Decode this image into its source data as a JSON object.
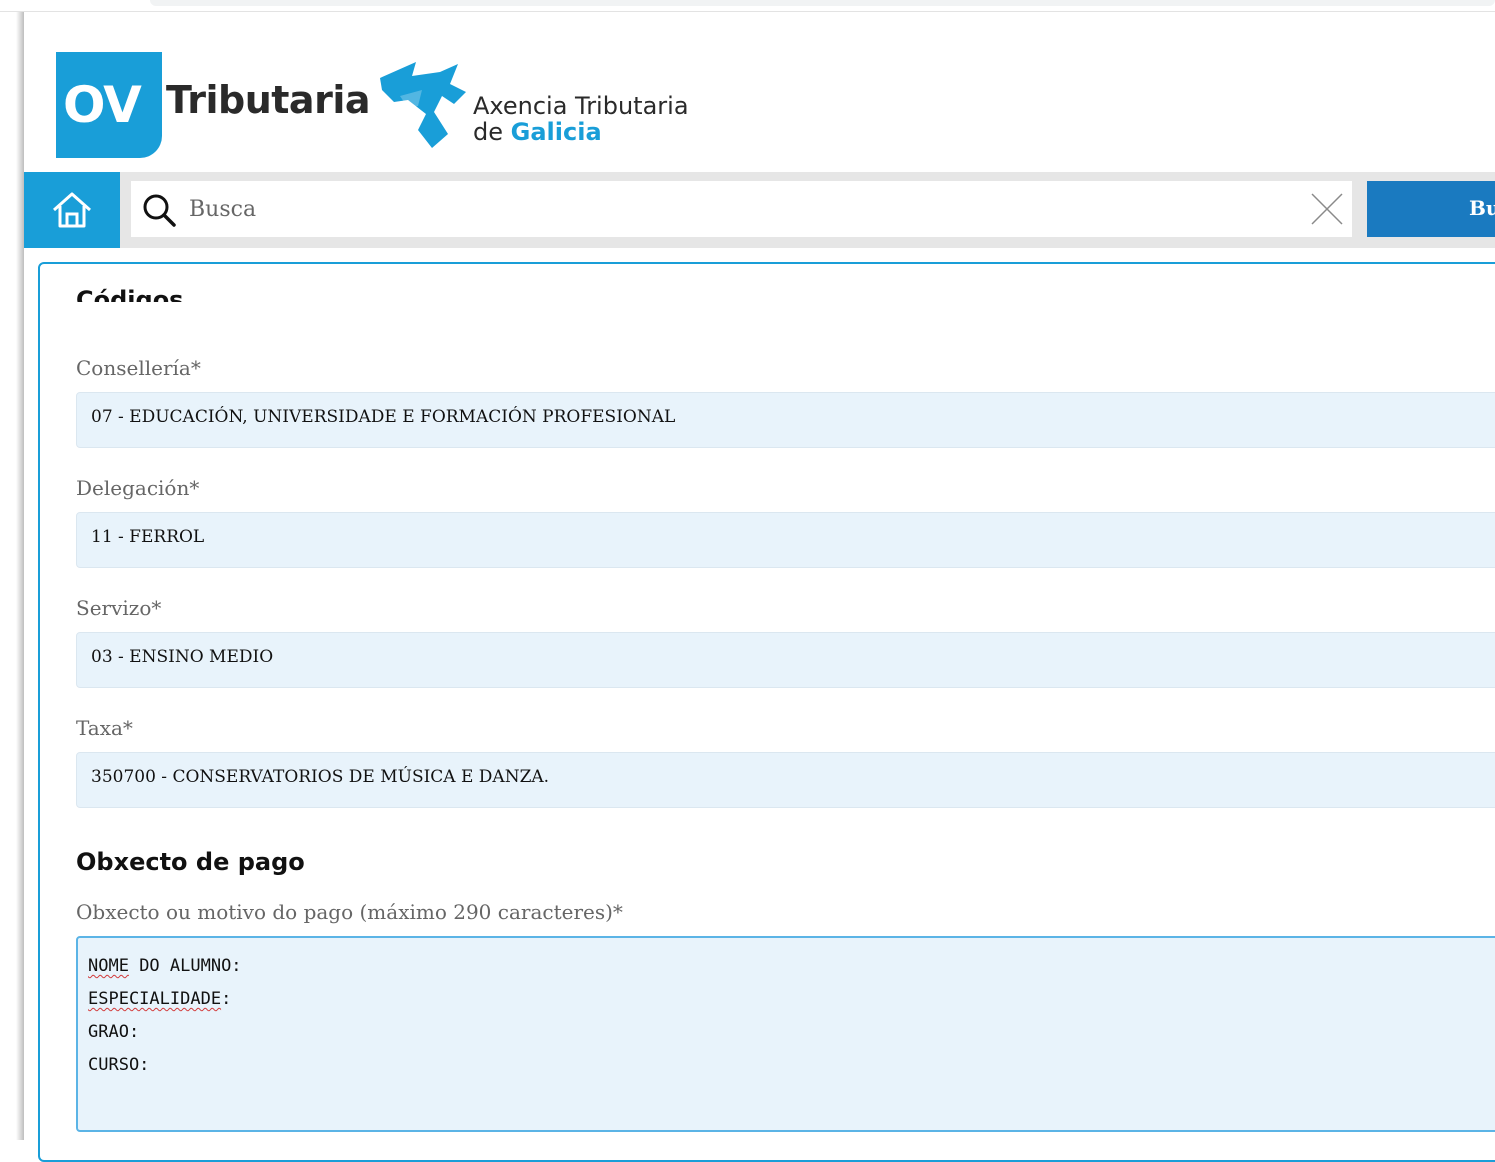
{
  "header": {
    "ov_logo_text": "OV",
    "ov_product_text": "Tributaria",
    "agency_line1": "Axencia Tributaria",
    "agency_line2_prefix": "de",
    "agency_line2_highlight": "Galicia",
    "brand_color": "#199ed8"
  },
  "search": {
    "placeholder": "Busca",
    "button_label": "Busca",
    "icons": {
      "home": "home-icon",
      "search": "search-icon",
      "clear": "close-icon"
    }
  },
  "form": {
    "codes_heading": "Códigos",
    "fields": [
      {
        "label": "Consellería*",
        "value": "07 - EDUCACIÓN, UNIVERSIDADE E FORMACIÓN PROFESIONAL"
      },
      {
        "label": "Delegación*",
        "value": "11 - FERROL"
      },
      {
        "label": "Servizo*",
        "value": "03 - ENSINO MEDIO"
      },
      {
        "label": "Taxa*",
        "value": "350700 - CONSERVATORIOS DE MÚSICA E DANZA."
      }
    ],
    "payment_heading": "Obxecto de pago",
    "payment_label": "Obxecto ou motivo do pago (máximo 290 caracteres)*",
    "payment_text": {
      "line1_word1": "NOME",
      "line1_rest": " DO ALUMNO:",
      "line2_word": "ESPECIALIDADE",
      "line2_rest": ":",
      "line3": "GRAO:",
      "line4": "CURSO:"
    }
  }
}
